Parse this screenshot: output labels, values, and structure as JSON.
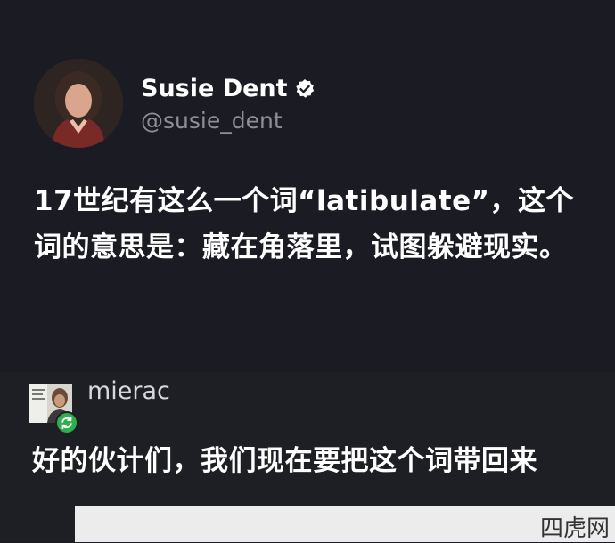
{
  "post": {
    "display_name": "Susie Dent",
    "handle": "@susie_dent",
    "verified": true,
    "text": "17世纪有这么一个词“latibulate”，这个词的意思是：藏在角落里，试图躲避现实。"
  },
  "reply": {
    "username": "mierac",
    "text": "好的伙计们，我们现在要把这个词带回来"
  },
  "watermark": {
    "text": "四虎网"
  },
  "colors": {
    "background": "#1b1c23",
    "reply_background": "#1e1f24",
    "handle_gray": "#8d8f97",
    "repost_green": "#2fae4e"
  },
  "icons": {
    "verified": "verified-badge-icon",
    "repost": "repost-icon"
  }
}
